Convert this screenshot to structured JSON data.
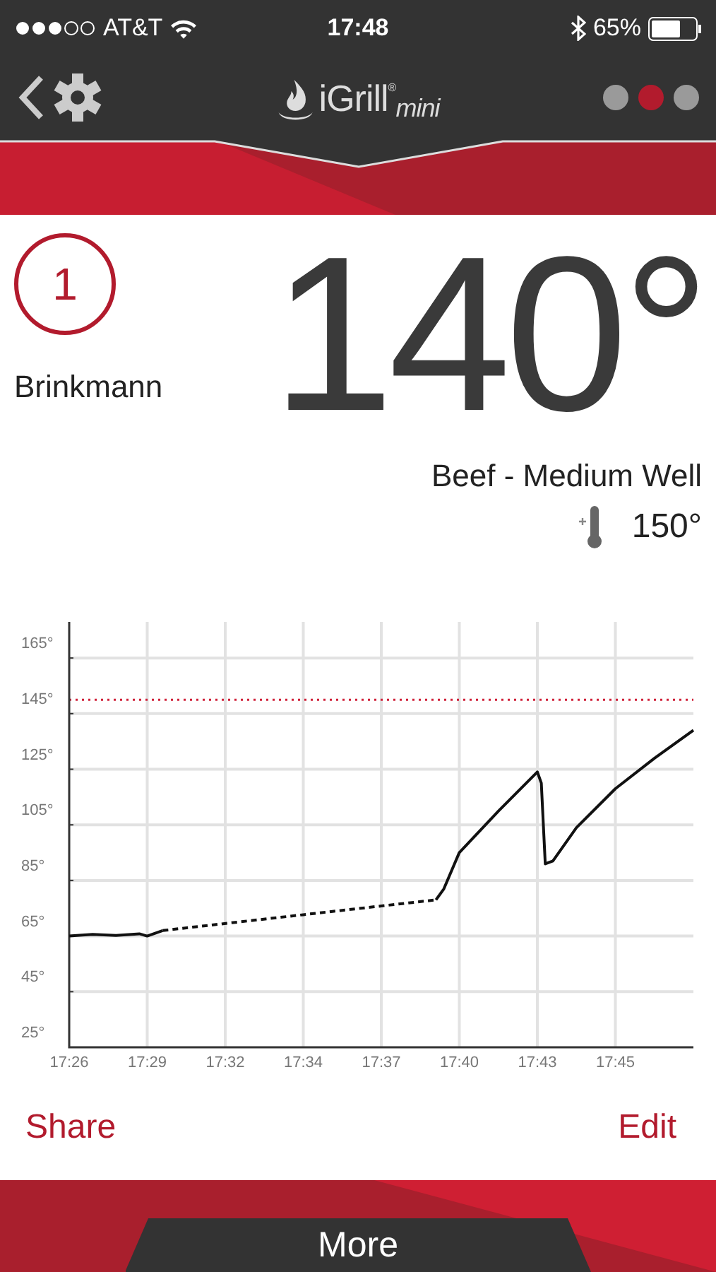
{
  "status_bar": {
    "carrier": "AT&T",
    "time": "17:48",
    "battery": "65%"
  },
  "header": {
    "logo": "iGrill$^{®}$$_{mini}$",
    "pages": [
      {
        "selected": false
      },
      {
        "selected": true
      },
      {
        "selected": false
      }
    ]
  },
  "probe": {
    "number": "1",
    "name": "Brinkmann",
    "temperature": "140°",
    "preset": "Beef - Medium Well",
    "target": "150°"
  },
  "graph": {
    "chart_data": {
      "type": "line",
      "x": [
        1046,
        1046.83,
        1047.66,
        1048.49,
        1048.77,
        1049.32,
        1054.31,
        1059.02,
        1059.3,
        1059.85,
        1061.24,
        1062.62,
        1062.76,
        1062.9,
        1063.17,
        1064.01,
        1065.39,
        1066.78,
        1068.16
      ],
      "xlim": [
        1046,
        1068.16
      ],
      "ylim": [
        25,
        178
      ],
      "xticks": [
        {
          "value": 1046,
          "label": "17:26"
        },
        {
          "value": 1048.77,
          "label": "17:29"
        },
        {
          "value": 1051.54,
          "label": "17:32"
        },
        {
          "value": 1054.31,
          "label": "17:34"
        },
        {
          "value": 1057.08,
          "label": "17:37"
        },
        {
          "value": 1059.85,
          "label": "17:40"
        },
        {
          "value": 1062.62,
          "label": "17:43"
        },
        {
          "value": 1065.39,
          "label": "17:45"
        }
      ],
      "yticks": [
        {
          "value": 25,
          "label": "25°"
        },
        {
          "value": 45,
          "label": "45°"
        },
        {
          "value": 65,
          "label": "65°"
        },
        {
          "value": 85,
          "label": "85°"
        },
        {
          "value": 105,
          "label": "105°"
        },
        {
          "value": 125,
          "label": "125°"
        },
        {
          "value": 145,
          "label": "145°"
        },
        {
          "value": 165,
          "label": "165°"
        }
      ],
      "series": [
        {
          "color": "#111111",
          "values": [
            65,
            65.6,
            65.2,
            65.8,
            65,
            67,
            null,
            78,
            82,
            95,
            110,
            124,
            120,
            91,
            92,
            104,
            118,
            129,
            139
          ]
        }
      ],
      "grid": true,
      "ref_lines": [
        {
          "axis": "y",
          "value": 150,
          "color": "#d0213a"
        }
      ]
    }
  },
  "actions": {
    "share": "Share",
    "edit": "Edit"
  },
  "footer": {
    "tab": "More"
  }
}
